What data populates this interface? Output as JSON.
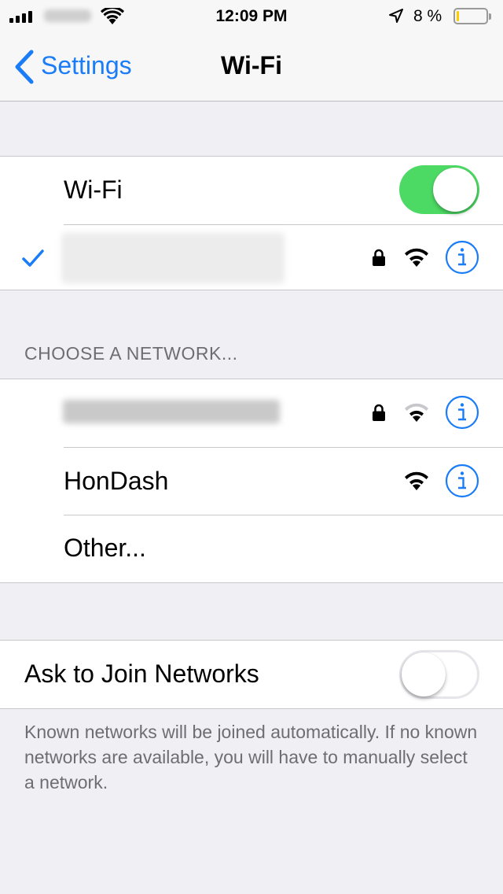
{
  "status_bar": {
    "time": "12:09 PM",
    "battery_percent": "8 %",
    "battery_level": 0.08,
    "battery_color": "#ffcc00",
    "signal_bars": 4,
    "icons": [
      "signal-icon",
      "wifi-icon",
      "location-arrow-icon",
      "battery-icon"
    ]
  },
  "nav": {
    "back_label": "Settings",
    "title": "Wi-Fi"
  },
  "wifi_group": {
    "wifi_label": "Wi-Fi",
    "wifi_enabled": true,
    "connected_network": {
      "checked": true,
      "secured": true,
      "icons": [
        "checkmark-icon",
        "lock-icon",
        "wifi-signal-icon",
        "info-icon"
      ]
    }
  },
  "choose_network": {
    "header": "CHOOSE A NETWORK...",
    "networks": [
      {
        "name": "",
        "secured": true,
        "signal": "weak"
      },
      {
        "name": "HonDash",
        "secured": false,
        "signal": "full"
      }
    ],
    "other_label": "Other..."
  },
  "ask_to_join": {
    "label": "Ask to Join Networks",
    "enabled": false,
    "footer": "Known networks will be joined automatically. If no known networks are available, you will have to manually select a network."
  },
  "colors": {
    "accent": "#1a7cf7",
    "toggle_on": "#4cd964",
    "background": "#efeff4"
  }
}
